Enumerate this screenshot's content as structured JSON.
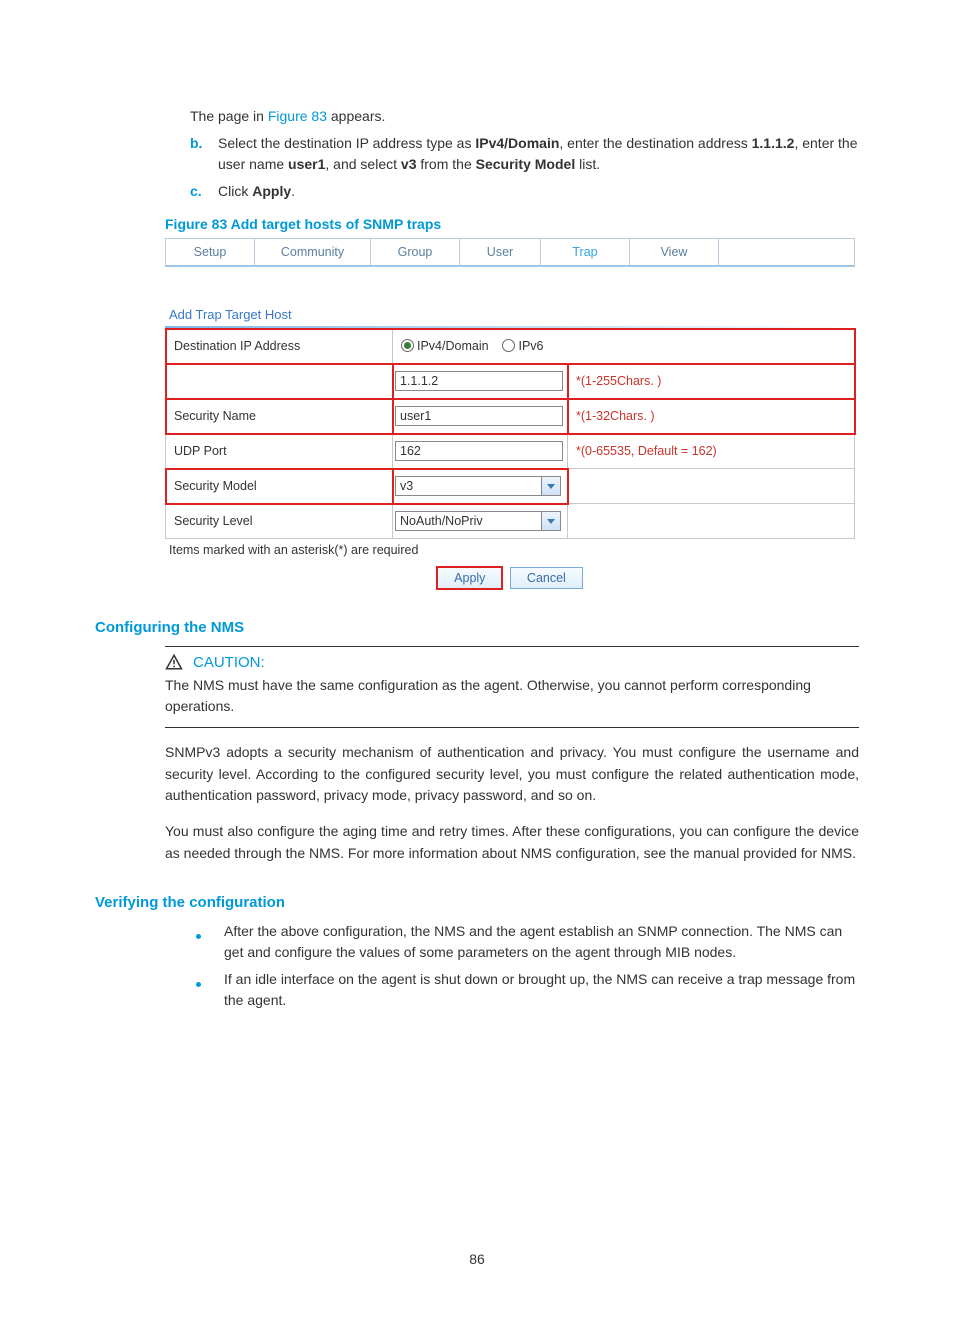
{
  "intro": {
    "line_pre": "The page in ",
    "line_link": "Figure 83",
    "line_post": " appears."
  },
  "steps": {
    "b": {
      "marker": "b.",
      "pre": "Select the destination IP address type as ",
      "bold1": "IPv4/Domain",
      "mid1": ", enter the destination address ",
      "bold2": "1.1.1.2",
      "mid2": ", enter the user name ",
      "bold3": "user1",
      "mid3": ", and select ",
      "bold4": "v3",
      "mid4": " from the ",
      "bold5": "Security Model",
      "post": " list."
    },
    "c": {
      "marker": "c.",
      "pre": "Click ",
      "bold1": "Apply",
      "post": "."
    }
  },
  "figure_caption": "Figure 83 Add target hosts of SNMP traps",
  "ui": {
    "tabs": [
      "Setup",
      "Community",
      "Group",
      "User",
      "Trap",
      "View"
    ],
    "tab_widths": [
      88,
      115,
      88,
      80,
      88,
      88
    ],
    "active_tab_index": 4,
    "form_title": "Add Trap Target Host",
    "rows": {
      "dest_label": "Destination IP Address",
      "radio1": "IPv4/Domain",
      "radio2": "IPv6",
      "addr_value": "1.1.1.2",
      "addr_hint": "*(1-255Chars. )",
      "secname_label": "Security Name",
      "secname_value": "user1",
      "secname_hint": "*(1-32Chars. )",
      "udp_label": "UDP Port",
      "udp_value": "162",
      "udp_hint": "*(0-65535, Default = 162)",
      "model_label": "Security Model",
      "model_value": "v3",
      "level_label": "Security Level",
      "level_value": "NoAuth/NoPriv"
    },
    "note": "Items marked with an asterisk(*) are required",
    "btn_apply": "Apply",
    "btn_cancel": "Cancel"
  },
  "section1_heading": "Configuring the NMS",
  "caution": {
    "label": "CAUTION:",
    "text": "The NMS must have the same configuration as the agent. Otherwise, you cannot perform corresponding operations."
  },
  "para1": "SNMPv3 adopts a security mechanism of authentication and privacy. You must configure the username and security level. According to the configured security level, you must configure the related authentication mode, authentication password, privacy mode, privacy password, and so on.",
  "para2": "You must also configure the aging time and retry times. After these configurations, you can configure the device as needed through the NMS. For more information about NMS configuration, see the manual provided for NMS.",
  "section2_heading": "Verifying the configuration",
  "bullets": [
    "After the above configuration, the NMS and the agent establish an SNMP connection. The NMS can get and configure the values of some parameters on the agent through MIB nodes.",
    "If an idle interface on the agent is shut down or brought up, the NMS can receive a trap message from the agent."
  ],
  "page_number": "86"
}
